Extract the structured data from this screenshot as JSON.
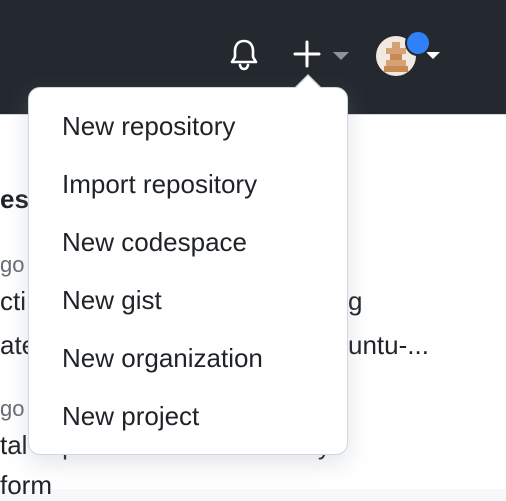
{
  "header": {
    "notifications_icon": "bell-icon",
    "create_icon": "plus-icon",
    "create_dropdown_icon": "caret-down-icon",
    "avatar_icon": "user-avatar",
    "colors": {
      "header_bg": "#24292f",
      "notification_dot": "#2f81f7"
    }
  },
  "background_feed": {
    "heading_fragment": "es",
    "items": [
      {
        "time_fragment": "go",
        "line1": "cti",
        "line1_tail": "g",
        "line2": "ate",
        "line2_tail": "untu-..."
      },
      {
        "time_fragment": "go",
        "line1": "tal improvements on security",
        "line2": "form"
      }
    ]
  },
  "create_menu": {
    "items": [
      {
        "label": "New repository"
      },
      {
        "label": "Import repository"
      },
      {
        "label": "New codespace"
      },
      {
        "label": "New gist"
      },
      {
        "label": "New organization"
      },
      {
        "label": "New project"
      }
    ]
  }
}
